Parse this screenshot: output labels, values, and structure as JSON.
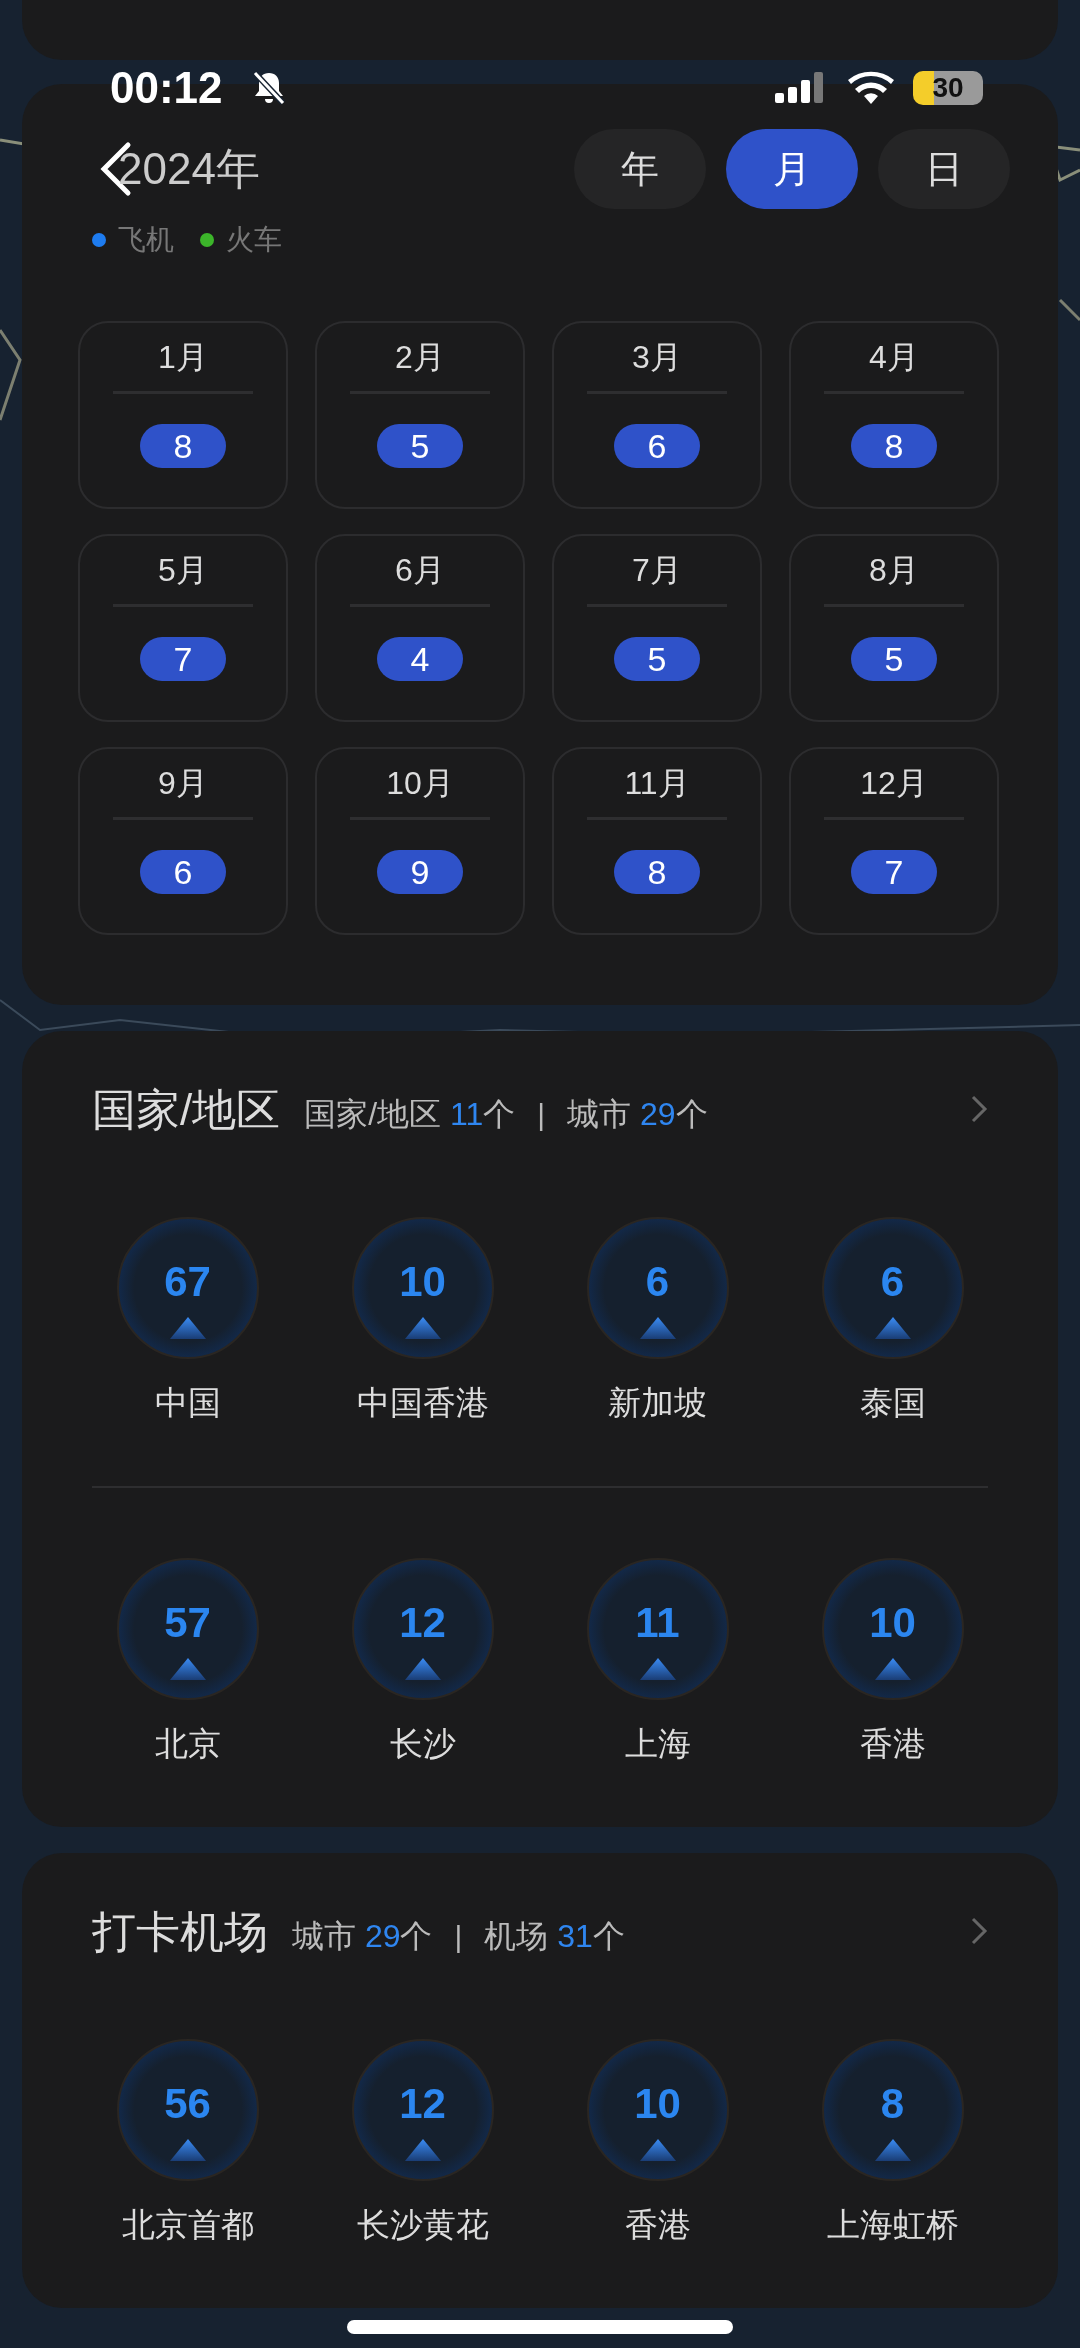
{
  "status_bar": {
    "time": "00:12",
    "battery": "30"
  },
  "header": {
    "title": "2024年",
    "tabs": [
      {
        "label": "年",
        "selected": false
      },
      {
        "label": "月",
        "selected": true
      },
      {
        "label": "日",
        "selected": false
      }
    ]
  },
  "legend": [
    {
      "label": "飞机",
      "color": "#1e7cf0"
    },
    {
      "label": "火车",
      "color": "#3cb52a"
    }
  ],
  "months": [
    {
      "label": "1月",
      "count": "8"
    },
    {
      "label": "2月",
      "count": "5"
    },
    {
      "label": "3月",
      "count": "6"
    },
    {
      "label": "4月",
      "count": "8"
    },
    {
      "label": "5月",
      "count": "7"
    },
    {
      "label": "6月",
      "count": "4"
    },
    {
      "label": "7月",
      "count": "5"
    },
    {
      "label": "8月",
      "count": "5"
    },
    {
      "label": "9月",
      "count": "6"
    },
    {
      "label": "10月",
      "count": "9"
    },
    {
      "label": "11月",
      "count": "8"
    },
    {
      "label": "12月",
      "count": "7"
    }
  ],
  "sections": [
    {
      "title": "国家/地区",
      "separator": "|",
      "summary": [
        {
          "label": "国家/地区",
          "value": "11",
          "unit": "个"
        },
        {
          "label": "城市",
          "value": "29",
          "unit": "个"
        }
      ],
      "rows": [
        [
          {
            "value": "67",
            "label": "中国"
          },
          {
            "value": "10",
            "label": "中国香港"
          },
          {
            "value": "6",
            "label": "新加坡"
          },
          {
            "value": "6",
            "label": "泰国"
          }
        ],
        [
          {
            "value": "57",
            "label": "北京"
          },
          {
            "value": "12",
            "label": "长沙"
          },
          {
            "value": "11",
            "label": "上海"
          },
          {
            "value": "10",
            "label": "香港"
          }
        ]
      ]
    },
    {
      "title": "打卡机场",
      "separator": "|",
      "summary": [
        {
          "label": "城市",
          "value": "29",
          "unit": "个"
        },
        {
          "label": "机场",
          "value": "31",
          "unit": "个"
        }
      ],
      "rows": [
        [
          {
            "value": "56",
            "label": "北京首都"
          },
          {
            "value": "12",
            "label": "长沙黄花"
          },
          {
            "value": "10",
            "label": "香港"
          },
          {
            "value": "8",
            "label": "上海虹桥"
          }
        ]
      ]
    }
  ]
}
